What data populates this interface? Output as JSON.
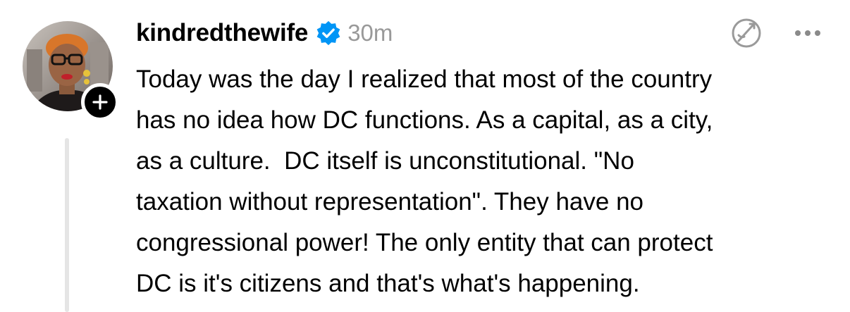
{
  "post": {
    "username": "kindredthewife",
    "timestamp": "30m",
    "verified": true,
    "avatar_icon": "profile-photo",
    "follow_icon": "plus-icon",
    "verified_icon": "verified-badge-icon",
    "actions": {
      "translate_icon": "translate-icon",
      "more_icon": "more-options-icon"
    },
    "text": "Today was the day I realized that most of the country\nhas no idea how DC functions. As a capital, as a city,\nas a culture.  DC itself is unconstitutional. \"No\ntaxation without representation\". They have no\ncongressional power! The only entity that can protect\nDC is it's citizens and that's what's happening."
  },
  "colors": {
    "verified_blue": "#0095f6",
    "timestamp_gray": "#999999",
    "thread_line": "#e5e5e5",
    "text": "#000000"
  }
}
